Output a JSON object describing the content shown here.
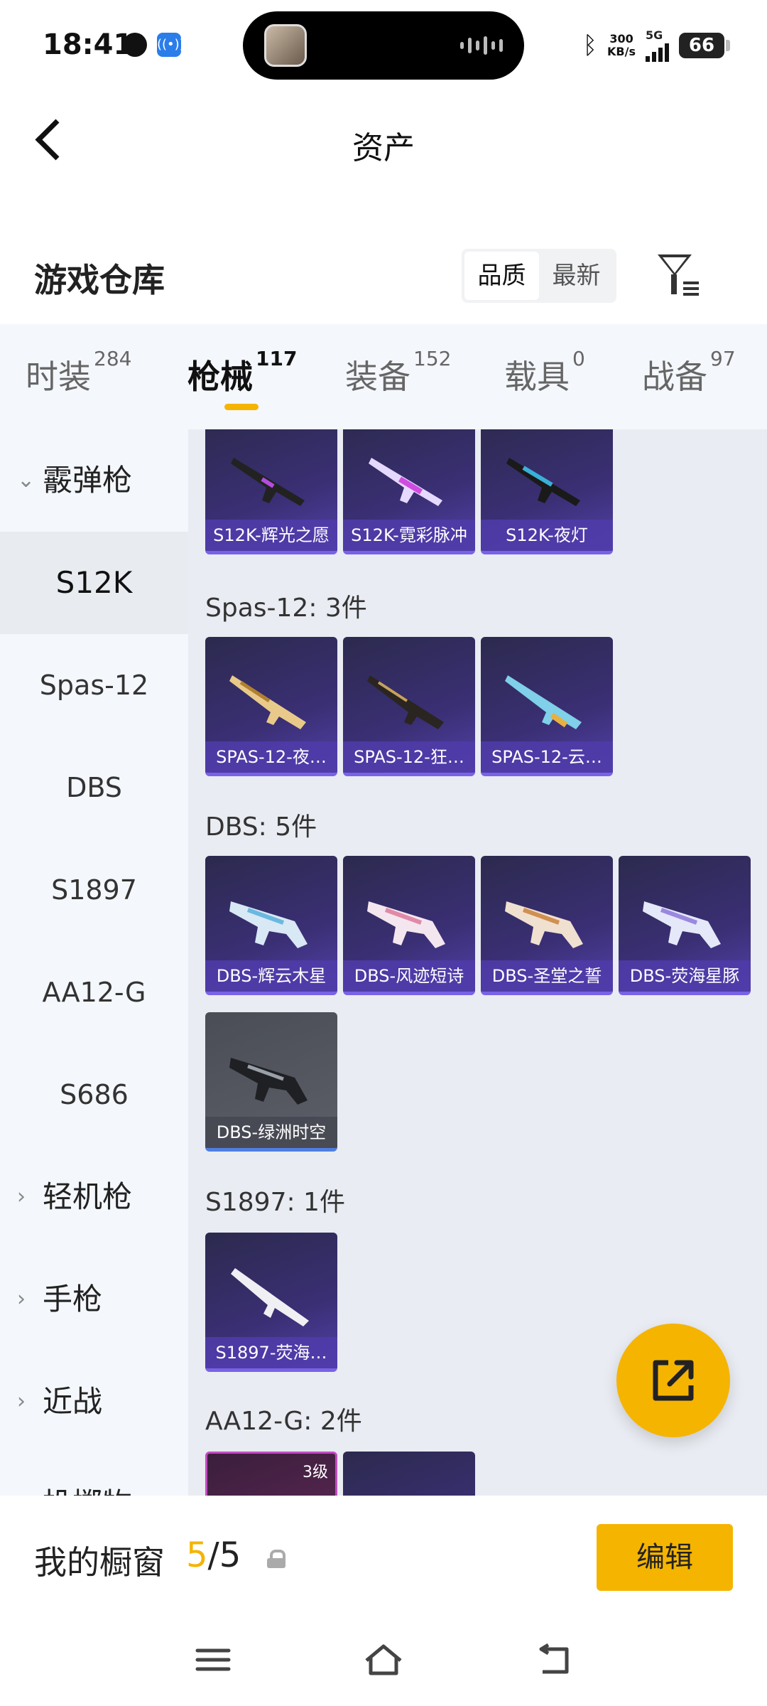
{
  "status_bar": {
    "time": "18:41",
    "speed_value": "300",
    "speed_unit": "KB/s",
    "network": "5G",
    "battery": "66"
  },
  "header": {
    "title": "资产"
  },
  "warehouse": {
    "title": "游戏仓库",
    "sort_options": [
      "品质",
      "最新"
    ],
    "sort_selected": "品质"
  },
  "tabs": [
    {
      "label": "时装",
      "count": "284"
    },
    {
      "label": "枪械",
      "count": "117",
      "active": true
    },
    {
      "label": "装备",
      "count": "152"
    },
    {
      "label": "载具",
      "count": "0"
    },
    {
      "label": "战备",
      "count": "97"
    }
  ],
  "sidebar": {
    "group_shotgun": "霰弹枪",
    "items": [
      "S12K",
      "Spas-12",
      "DBS",
      "S1897",
      "AA12-G",
      "S686"
    ],
    "selected": "S12K",
    "group_lmg": "轻机枪",
    "group_pistol": "手枪",
    "group_melee": "近战",
    "group_partial": "投掷物"
  },
  "sections": {
    "s12k_cards": [
      "S12K-辉光之愿",
      "S12K-霓彩脉冲",
      "S12K-夜灯"
    ],
    "spas_title": "Spas-12: 3件",
    "spas_cards": [
      "SPAS-12-夜…",
      "SPAS-12-狂…",
      "SPAS-12-云…"
    ],
    "dbs_title": "DBS: 5件",
    "dbs_cards": [
      "DBS-辉云木星",
      "DBS-风迹短诗",
      "DBS-圣堂之誓",
      "DBS-荧海星豚",
      "DBS-绿洲时空"
    ],
    "s1897_title": "S1897: 1件",
    "s1897_cards": [
      "S1897-荧海…"
    ],
    "aa12_title": "AA12-G: 2件",
    "aa12_level": "3级"
  },
  "bottom": {
    "label": "我的橱窗",
    "count_current": "5",
    "count_total": "/5",
    "edit": "编辑"
  },
  "colors": {
    "accent": "#f5b400",
    "card_purple": "#3a2f74",
    "tab_bg": "#f4f7fb"
  }
}
